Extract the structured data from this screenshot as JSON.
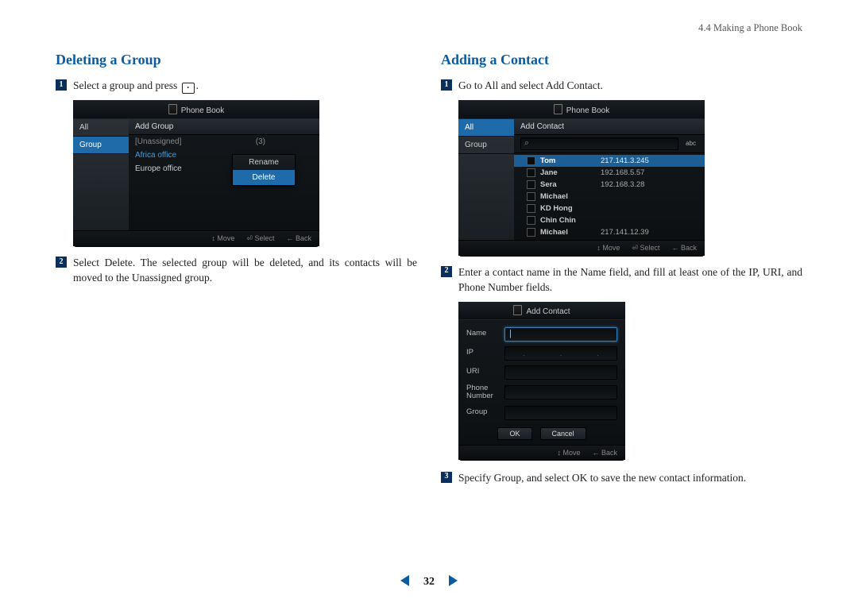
{
  "header": {
    "breadcrumb": "4.4 Making a Phone Book"
  },
  "left": {
    "title": "Deleting a Group",
    "step1_pre": "Select a group and press ",
    "step1_post": ".",
    "step2": "Select Delete. The selected group will be deleted, and its contacts will be moved to the Unassigned group.",
    "screen": {
      "title": "Phone Book",
      "nav": {
        "all": "All",
        "group": "Group"
      },
      "main_head": "Add Group",
      "rows": {
        "unassigned": "[Unassigned]",
        "unassigned_count": "(3)",
        "africa": "Africa office",
        "europe": "Europe office"
      },
      "menu": {
        "rename": "Rename",
        "delete": "Delete"
      },
      "footer": {
        "move": "↕ Move",
        "select": "⏎ Select",
        "back": "← Back"
      }
    }
  },
  "right": {
    "title": "Adding a Contact",
    "step1": "Go to All and select Add Contact.",
    "step2": "Enter a contact name in the Name field, and fill at least one of the IP, URI, and Phone Number fields.",
    "step3": "Specify Group, and select OK to save the new contact information.",
    "screen1": {
      "title": "Phone Book",
      "nav": {
        "all": "All",
        "group": "Group"
      },
      "main_head": "Add Contact",
      "abc": "abc",
      "contacts": [
        {
          "name": "Tom",
          "ip": "217.141.3.245",
          "sel": true
        },
        {
          "name": "Jane",
          "ip": "192.168.5.57"
        },
        {
          "name": "Sera",
          "ip": "192.168.3.28"
        },
        {
          "name": "Michael",
          "ip": ""
        },
        {
          "name": "KD Hong",
          "ip": ""
        },
        {
          "name": "Chin Chin",
          "ip": ""
        },
        {
          "name": "Michael",
          "ip": "217.141.12.39"
        }
      ],
      "footer": {
        "move": "↕ Move",
        "select": "⏎ Select",
        "back": "← Back"
      }
    },
    "screen2": {
      "title": "Add Contact",
      "labels": {
        "name": "Name",
        "ip": "IP",
        "uri": "URI",
        "phone": "Phone\nNumber",
        "group": "Group"
      },
      "buttons": {
        "ok": "OK",
        "cancel": "Cancel"
      },
      "footer": {
        "move": "↕ Move",
        "back": "← Back"
      }
    }
  },
  "pager": {
    "page": "32"
  }
}
